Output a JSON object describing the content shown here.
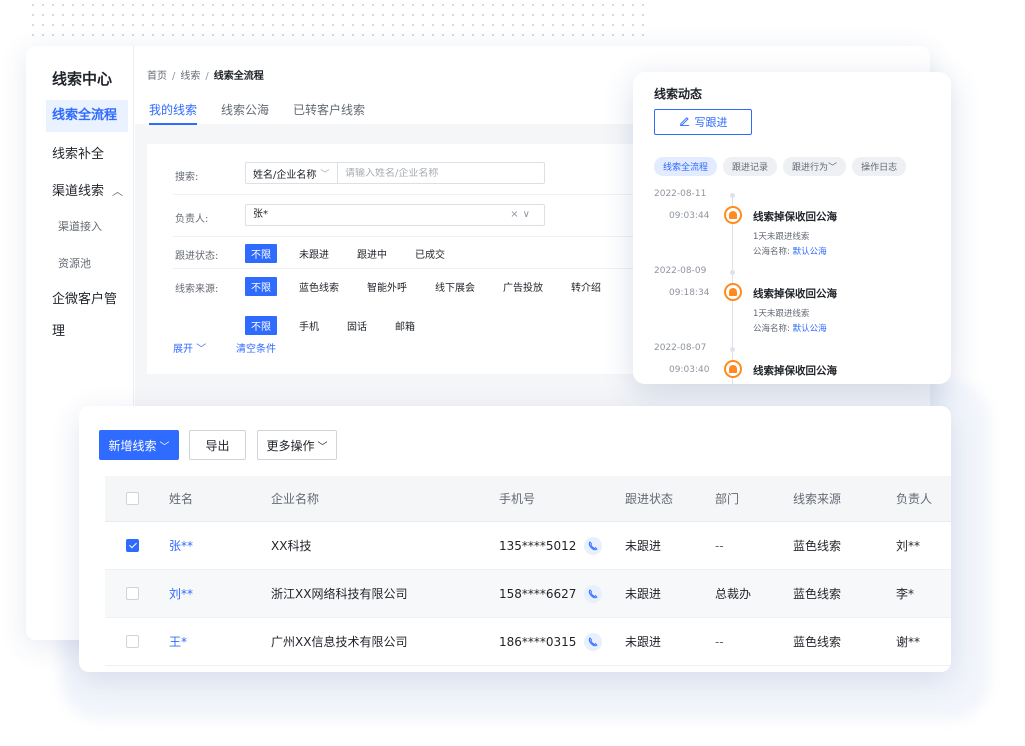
{
  "sidebar": {
    "brand": "线索中心",
    "items": [
      {
        "label": "线索全流程"
      },
      {
        "label": "线索补全"
      },
      {
        "label": "渠道线索"
      },
      {
        "label": "渠道接入"
      },
      {
        "label": "资源池"
      },
      {
        "label": "企微客户管理"
      }
    ],
    "group_chevron": "chevron-up-icon"
  },
  "breadcrumb": [
    "首页",
    "线索",
    "线索全流程"
  ],
  "tabs": [
    "我的线索",
    "线索公海",
    "已转客户线索"
  ],
  "filters": {
    "search_label": "搜索:",
    "search_type": "姓名/企业名称",
    "search_placeholder": "请输入姓名/企业名称",
    "owner_label": "负责人:",
    "owner_value": "张*",
    "status_label": "跟进状态:",
    "status_options": [
      "不限",
      "未跟进",
      "跟进中",
      "已成交"
    ],
    "source_label": "线索来源:",
    "source_options": [
      "不限",
      "蓝色线索",
      "智能外呼",
      "线下展会",
      "广告投放",
      "转介绍"
    ],
    "contact_options": [
      "不限",
      "手机",
      "固话",
      "邮箱"
    ],
    "expand_label": "展开",
    "clear_label": "清空条件"
  },
  "activity": {
    "title": "线索动态",
    "write_button": "写跟进",
    "tabs": [
      "线索全流程",
      "跟进记录",
      "跟进行为",
      "操作日志"
    ],
    "events": [
      {
        "date": "2022-08-11",
        "time": "09:03:44",
        "title": "线索掉保收回公海",
        "detail": "1天未跟进线索",
        "pool_label": "公海名称:",
        "pool_name": "默认公海"
      },
      {
        "date": "2022-08-09",
        "time": "09:18:34",
        "title": "线索掉保收回公海",
        "detail": "1天未跟进线索",
        "pool_label": "公海名称:",
        "pool_name": "默认公海"
      },
      {
        "date": "2022-08-07",
        "time": "09:03:40",
        "title": "线索掉保收回公海",
        "detail": "",
        "pool_label": "",
        "pool_name": ""
      }
    ]
  },
  "toolbar": {
    "new_lead": "新增线索",
    "export": "导出",
    "more": "更多操作"
  },
  "table": {
    "columns": [
      "姓名",
      "企业名称",
      "手机号",
      "跟进状态",
      "部门",
      "线索来源",
      "负责人"
    ],
    "rows": [
      {
        "checked": true,
        "name": "张**",
        "company": "XX科技",
        "phone": "135****5012",
        "status": "未跟进",
        "dept": "--",
        "source": "蓝色线索",
        "owner": "刘**"
      },
      {
        "checked": false,
        "name": "刘**",
        "company": "浙江XX网络科技有限公司",
        "phone": "158****6627",
        "status": "未跟进",
        "dept": "总裁办",
        "source": "蓝色线索",
        "owner": "李*"
      },
      {
        "checked": false,
        "name": "王*",
        "company": "广州XX信息技术有限公司",
        "phone": "186****0315",
        "status": "未跟进",
        "dept": "--",
        "source": "蓝色线索",
        "owner": "谢**"
      }
    ]
  },
  "colors": {
    "primary": "#2f6bff",
    "accent_orange": "#ff8a1f"
  }
}
